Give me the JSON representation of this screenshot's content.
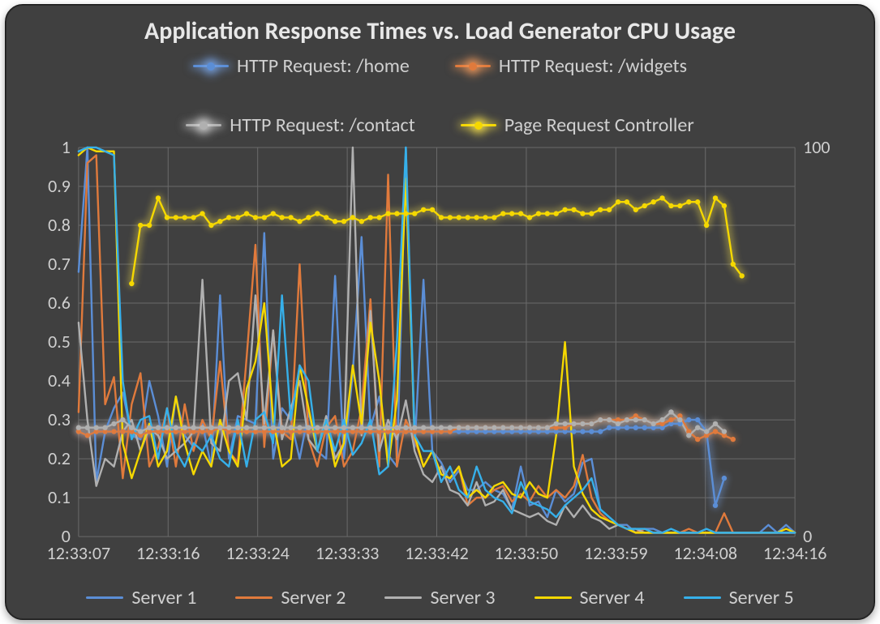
{
  "chart_data": {
    "type": "line",
    "title": "Application Response Times vs. Load Generator CPU Usage",
    "xlabel": "",
    "ylabel_left": "",
    "ylabel_right": "",
    "ylim_left": [
      0,
      1
    ],
    "ylim_right": [
      0,
      100
    ],
    "xticks": [
      "12:33:07",
      "12:33:16",
      "12:33:24",
      "12:33:33",
      "12:33:42",
      "12:33:50",
      "12:33:59",
      "12:34:08",
      "12:34:16"
    ],
    "yticks_left": [
      "0",
      "0.1",
      "0.2",
      "0.3",
      "0.4",
      "0.5",
      "0.6",
      "0.7",
      "0.8",
      "0.9",
      "1"
    ],
    "yticks_right": [
      "0",
      "100"
    ],
    "x_index": [
      0,
      1,
      2,
      3,
      4,
      5,
      6,
      7,
      8,
      9,
      10,
      11,
      12,
      13,
      14,
      15,
      16,
      17,
      18,
      19,
      20,
      21,
      22,
      23,
      24,
      25,
      26,
      27,
      28,
      29,
      30,
      31,
      32,
      33,
      34,
      35,
      36,
      37,
      38,
      39,
      40,
      41,
      42,
      43,
      44,
      45,
      46,
      47,
      48,
      49,
      50,
      51,
      52,
      53,
      54,
      55,
      56,
      57,
      58,
      59,
      60,
      61,
      62,
      63,
      64,
      65,
      66,
      67,
      68,
      69,
      70,
      71,
      72,
      73,
      74,
      75,
      76,
      77,
      78,
      79,
      80,
      81
    ],
    "dotted_series": [
      {
        "name": "HTTP Request: /home",
        "color": "#5b8ed6",
        "glow": "#7aa6e8",
        "values": [
          0.27,
          0.26,
          0.27,
          0.27,
          0.27,
          0.27,
          0.27,
          0.26,
          0.27,
          0.27,
          0.27,
          0.27,
          0.27,
          0.27,
          0.27,
          0.27,
          0.28,
          0.27,
          0.27,
          0.27,
          0.27,
          0.27,
          0.27,
          0.27,
          0.27,
          0.27,
          0.27,
          0.27,
          0.27,
          0.27,
          0.27,
          0.27,
          0.27,
          0.27,
          0.27,
          0.27,
          0.27,
          0.27,
          0.27,
          0.27,
          0.27,
          0.27,
          0.27,
          0.27,
          0.27,
          0.27,
          0.27,
          0.27,
          0.27,
          0.27,
          0.27,
          0.27,
          0.27,
          0.27,
          0.27,
          0.27,
          0.27,
          0.27,
          0.27,
          0.27,
          0.28,
          0.28,
          0.28,
          0.28,
          0.28,
          0.28,
          0.28,
          0.29,
          0.29,
          0.3,
          0.3,
          0.27,
          0.08,
          0.15,
          null,
          null,
          null,
          null,
          null,
          null,
          null,
          null
        ]
      },
      {
        "name": "HTTP Request: /widgets",
        "color": "#e07a3c",
        "glow": "#f59b5c",
        "values": [
          0.27,
          0.26,
          0.27,
          0.27,
          0.27,
          0.27,
          0.27,
          0.26,
          0.27,
          0.27,
          0.27,
          0.27,
          0.27,
          0.27,
          0.27,
          0.27,
          0.28,
          0.27,
          0.27,
          0.27,
          0.27,
          0.27,
          0.27,
          0.27,
          0.27,
          0.27,
          0.27,
          0.27,
          0.27,
          0.27,
          0.27,
          0.27,
          0.27,
          0.27,
          0.27,
          0.27,
          0.27,
          0.27,
          0.27,
          0.27,
          0.27,
          0.27,
          0.27,
          0.28,
          0.28,
          0.28,
          0.28,
          0.28,
          0.28,
          0.28,
          0.28,
          0.28,
          0.28,
          0.28,
          0.28,
          0.28,
          0.29,
          0.29,
          0.29,
          0.3,
          0.3,
          0.3,
          0.3,
          0.31,
          0.3,
          0.29,
          0.29,
          0.3,
          0.31,
          0.27,
          0.25,
          0.26,
          0.27,
          0.26,
          0.25,
          null,
          null,
          null,
          null,
          null,
          null,
          null
        ]
      },
      {
        "name": "HTTP Request: /contact",
        "color": "#b0b0b0",
        "glow": "#dcdcdc",
        "values": [
          0.28,
          0.28,
          0.28,
          0.28,
          0.29,
          0.3,
          0.28,
          0.27,
          0.28,
          0.28,
          0.28,
          0.28,
          0.28,
          0.28,
          0.28,
          0.28,
          0.28,
          0.28,
          0.28,
          0.28,
          0.28,
          0.28,
          0.28,
          0.28,
          0.28,
          0.28,
          0.28,
          0.28,
          0.28,
          0.28,
          0.28,
          0.28,
          0.28,
          0.28,
          0.28,
          0.28,
          0.28,
          0.28,
          0.28,
          0.28,
          0.28,
          0.28,
          0.28,
          0.28,
          0.28,
          0.28,
          0.28,
          0.28,
          0.28,
          0.28,
          0.28,
          0.28,
          0.28,
          0.28,
          0.29,
          0.29,
          0.29,
          0.29,
          0.29,
          0.3,
          0.3,
          0.29,
          0.3,
          0.3,
          0.3,
          0.29,
          0.3,
          0.32,
          0.3,
          0.26,
          0.28,
          0.27,
          0.29,
          0.27,
          null,
          null,
          null,
          null,
          null,
          null,
          null,
          null
        ]
      },
      {
        "name": "Page Request Controller",
        "color": "#f5d800",
        "glow": "#ffe94d",
        "values": [
          null,
          null,
          null,
          null,
          null,
          null,
          0.65,
          0.8,
          0.8,
          0.87,
          0.82,
          0.82,
          0.82,
          0.82,
          0.83,
          0.8,
          0.81,
          0.82,
          0.82,
          0.83,
          0.82,
          0.82,
          0.83,
          0.82,
          0.82,
          0.81,
          0.82,
          0.83,
          0.82,
          0.81,
          0.81,
          0.82,
          0.81,
          0.82,
          0.82,
          0.83,
          0.83,
          0.83,
          0.83,
          0.84,
          0.84,
          0.82,
          0.82,
          0.82,
          0.82,
          0.82,
          0.82,
          0.82,
          0.83,
          0.83,
          0.83,
          0.82,
          0.83,
          0.83,
          0.83,
          0.84,
          0.84,
          0.83,
          0.83,
          0.84,
          0.84,
          0.86,
          0.86,
          0.84,
          0.85,
          0.86,
          0.87,
          0.85,
          0.85,
          0.86,
          0.86,
          0.8,
          0.87,
          0.85,
          0.7,
          0.67,
          null,
          null,
          null,
          null,
          null,
          null
        ]
      }
    ],
    "plain_series": [
      {
        "name": "Server 1",
        "color": "#5b8ed6",
        "values": [
          0.68,
          1.0,
          0.14,
          0.27,
          0.33,
          0.37,
          0.26,
          0.25,
          0.4,
          0.31,
          0.18,
          0.36,
          0.26,
          0.23,
          0.29,
          0.18,
          0.62,
          0.2,
          0.31,
          0.3,
          0.29,
          0.78,
          0.2,
          0.33,
          0.3,
          0.2,
          0.32,
          0.22,
          0.2,
          0.67,
          0.2,
          0.42,
          0.77,
          0.28,
          0.36,
          0.21,
          0.18,
          1.0,
          0.23,
          0.66,
          0.22,
          0.19,
          0.14,
          0.17,
          0.12,
          0.12,
          0.14,
          0.12,
          0.11,
          0.07,
          0.18,
          0.08,
          0.09,
          0.05,
          0.12,
          0.09,
          0.11,
          0.19,
          0.2,
          0.07,
          0.05,
          0.03,
          0.03,
          0.01,
          0.02,
          0.02,
          0.01,
          0.01,
          0.01,
          0.01,
          0.01,
          0.01,
          0.01,
          0.01,
          0.01,
          0.01,
          0.01,
          0.01,
          0.03,
          0.01,
          0.03,
          0.01
        ]
      },
      {
        "name": "Server 2",
        "color": "#e07a3c",
        "values": [
          0.32,
          0.96,
          0.98,
          0.34,
          0.41,
          0.15,
          0.34,
          0.42,
          0.18,
          0.23,
          0.33,
          0.18,
          0.34,
          0.22,
          0.3,
          0.25,
          0.45,
          0.22,
          0.19,
          0.46,
          0.75,
          0.23,
          0.53,
          0.27,
          0.25,
          0.7,
          0.25,
          0.18,
          0.28,
          0.31,
          0.18,
          0.22,
          0.33,
          0.61,
          0.18,
          0.93,
          0.18,
          0.3,
          0.25,
          0.18,
          0.22,
          0.16,
          0.15,
          0.18,
          0.08,
          0.1,
          0.1,
          0.12,
          0.13,
          0.09,
          0.11,
          0.09,
          0.13,
          0.1,
          0.12,
          0.1,
          0.13,
          0.21,
          0.1,
          0.06,
          0.04,
          0.03,
          0.02,
          0.01,
          0.02,
          0.01,
          0.01,
          0.01,
          0.01,
          0.02,
          0.01,
          0.01,
          0.01,
          0.06,
          0.01,
          0.01,
          0.01,
          0.01,
          0.01,
          0.01,
          0.01,
          0.01
        ]
      },
      {
        "name": "Server 3",
        "color": "#b0b0b0",
        "values": [
          0.55,
          0.3,
          0.13,
          0.2,
          0.18,
          0.27,
          0.3,
          0.22,
          0.28,
          0.26,
          0.2,
          0.22,
          0.24,
          0.27,
          0.66,
          0.24,
          0.22,
          0.4,
          0.42,
          0.3,
          0.62,
          0.29,
          0.53,
          0.25,
          0.33,
          0.4,
          0.25,
          0.22,
          0.31,
          0.2,
          0.24,
          1.0,
          0.26,
          0.58,
          0.22,
          0.3,
          0.25,
          0.35,
          0.22,
          0.16,
          0.14,
          0.18,
          0.12,
          0.11,
          0.08,
          0.14,
          0.08,
          0.09,
          0.12,
          0.07,
          0.06,
          0.05,
          0.06,
          0.04,
          0.03,
          0.08,
          0.05,
          0.08,
          0.05,
          0.04,
          0.02,
          0.03,
          0.02,
          0.02,
          0.01,
          0.01,
          0.01,
          0.01,
          0.01,
          0.01,
          0.01,
          0.01,
          0.01,
          0.01,
          0.01,
          0.01,
          0.01,
          0.01,
          0.01,
          0.01,
          0.01,
          0.01
        ]
      },
      {
        "name": "Server 4",
        "color": "#f5d800",
        "values": [
          0.98,
          1.0,
          0.99,
          0.99,
          0.99,
          0.24,
          0.15,
          0.22,
          0.29,
          0.18,
          0.22,
          0.36,
          0.24,
          0.16,
          0.22,
          0.18,
          0.3,
          0.22,
          0.18,
          0.38,
          0.45,
          0.6,
          0.3,
          0.18,
          0.2,
          0.44,
          0.33,
          0.22,
          0.3,
          0.18,
          0.24,
          0.44,
          0.29,
          0.55,
          0.4,
          0.18,
          0.35,
          0.92,
          0.26,
          0.18,
          0.22,
          0.16,
          0.15,
          0.18,
          0.1,
          0.12,
          0.1,
          0.13,
          0.14,
          0.11,
          0.1,
          0.14,
          0.11,
          0.1,
          0.26,
          0.5,
          0.18,
          0.11,
          0.07,
          0.05,
          0.04,
          0.03,
          0.02,
          0.01,
          0.01,
          0.01,
          0.01,
          0.01,
          0.01,
          0.01,
          0.01,
          0.01,
          0.01,
          0.01,
          0.01,
          0.01,
          0.01,
          0.01,
          0.01,
          0.01,
          0.02,
          0.01
        ]
      },
      {
        "name": "Server 5",
        "color": "#36b0ea",
        "values": [
          0.99,
          1.0,
          1.0,
          0.99,
          0.98,
          0.4,
          0.25,
          0.3,
          0.31,
          0.2,
          0.33,
          0.22,
          0.18,
          0.24,
          0.22,
          0.26,
          0.2,
          0.18,
          0.3,
          0.18,
          0.3,
          0.32,
          0.24,
          0.62,
          0.3,
          0.44,
          0.4,
          0.22,
          0.3,
          0.22,
          0.3,
          0.21,
          0.24,
          0.3,
          0.16,
          0.18,
          0.5,
          1.0,
          0.26,
          0.22,
          0.22,
          0.14,
          0.18,
          0.12,
          0.1,
          0.18,
          0.12,
          0.1,
          0.09,
          0.06,
          0.14,
          0.09,
          0.08,
          0.07,
          0.05,
          0.08,
          0.1,
          0.12,
          0.15,
          0.07,
          0.05,
          0.03,
          0.02,
          0.02,
          0.02,
          0.01,
          0.01,
          0.02,
          0.01,
          0.01,
          0.01,
          0.02,
          0.01,
          0.01,
          0.01,
          0.01,
          0.01,
          0.01,
          0.01,
          0.01,
          0.01,
          0.01
        ]
      }
    ],
    "legend_top": [
      {
        "label": "HTTP Request: /home",
        "line": "#5b8ed6",
        "dot": "#5b8ed6",
        "glow": "#7aa6e8"
      },
      {
        "label": "HTTP Request: /widgets",
        "line": "#e07a3c",
        "dot": "#e07a3c",
        "glow": "#f59b5c"
      },
      {
        "label": "HTTP Request: /contact",
        "line": "#b0b0b0",
        "dot": "#b0b0b0",
        "glow": "#dcdcdc"
      },
      {
        "label": "Page Request Controller",
        "line": "#f5d800",
        "dot": "#f5d800",
        "glow": "#ffe94d"
      }
    ],
    "legend_bottom": [
      {
        "label": "Server 1",
        "line": "#5b8ed6"
      },
      {
        "label": "Server 2",
        "line": "#e07a3c"
      },
      {
        "label": "Server 3",
        "line": "#b0b0b0"
      },
      {
        "label": "Server 4",
        "line": "#f5d800"
      },
      {
        "label": "Server 5",
        "line": "#36b0ea"
      }
    ]
  }
}
